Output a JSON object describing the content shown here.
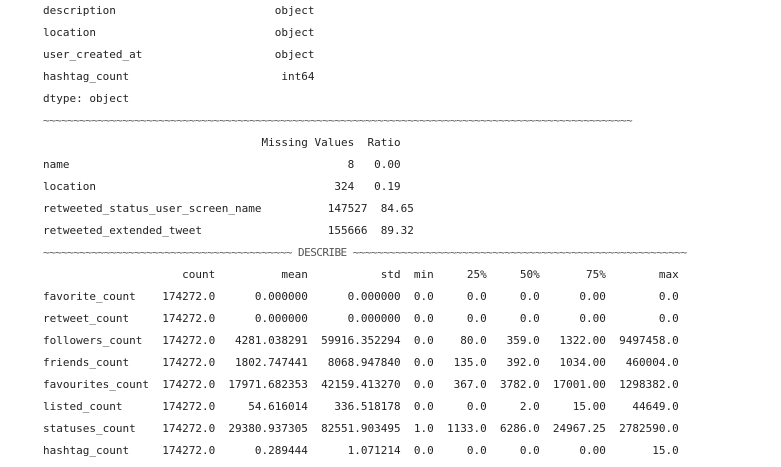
{
  "lines": [
    "description                        object",
    "location                           object",
    "user_created_at                    object",
    "hashtag_count                       int64",
    "dtype: object",
    "~~~~~~~~~~~~~~~~~~~~~~~~~~~~~~~~~~~~~~~~~~~~~~~~~~~~~~~~~~~~~~~~~~~~~~~~~~~~~~~~~~~~~~~~~~~~~~~~~",
    "                                 Missing Values  Ratio",
    "name                                          8   0.00",
    "location                                    324   0.19",
    "retweeted_status_user_screen_name          147527  84.65",
    "retweeted_extended_tweet                   155666  89.32",
    "~~~~~~~~~~~~~~~~~~~~~~~~~~~~~~~~~~~~~~~~~ DESCRIBE ~~~~~~~~~~~~~~~~~~~~~~~~~~~~~~~~~~~~~~~~~~~~~~~~~~~~~~~",
    "                     count          mean           std  min     25%     50%       75%        max",
    "favorite_count    174272.0      0.000000      0.000000  0.0     0.0     0.0      0.00        0.0",
    "retweet_count     174272.0      0.000000      0.000000  0.0     0.0     0.0      0.00        0.0",
    "followers_count   174272.0   4281.038291  59916.352294  0.0    80.0   359.0   1322.00  9497458.0",
    "friends_count     174272.0   1802.747441   8068.947840  0.0   135.0   392.0   1034.00   460004.0",
    "favourites_count  174272.0  17971.682353  42159.413270  0.0   367.0  3782.0  17001.00  1298382.0",
    "listed_count      174272.0     54.616014    336.518178  0.0     0.0     2.0     15.00    44649.0",
    "statuses_count    174272.0  29380.937305  82551.903495  1.0  1133.0  6286.0  24967.25  2782590.0",
    "hashtag_count     174272.0      0.289444      1.071214  0.0     0.0     0.0      0.00       15.0"
  ]
}
